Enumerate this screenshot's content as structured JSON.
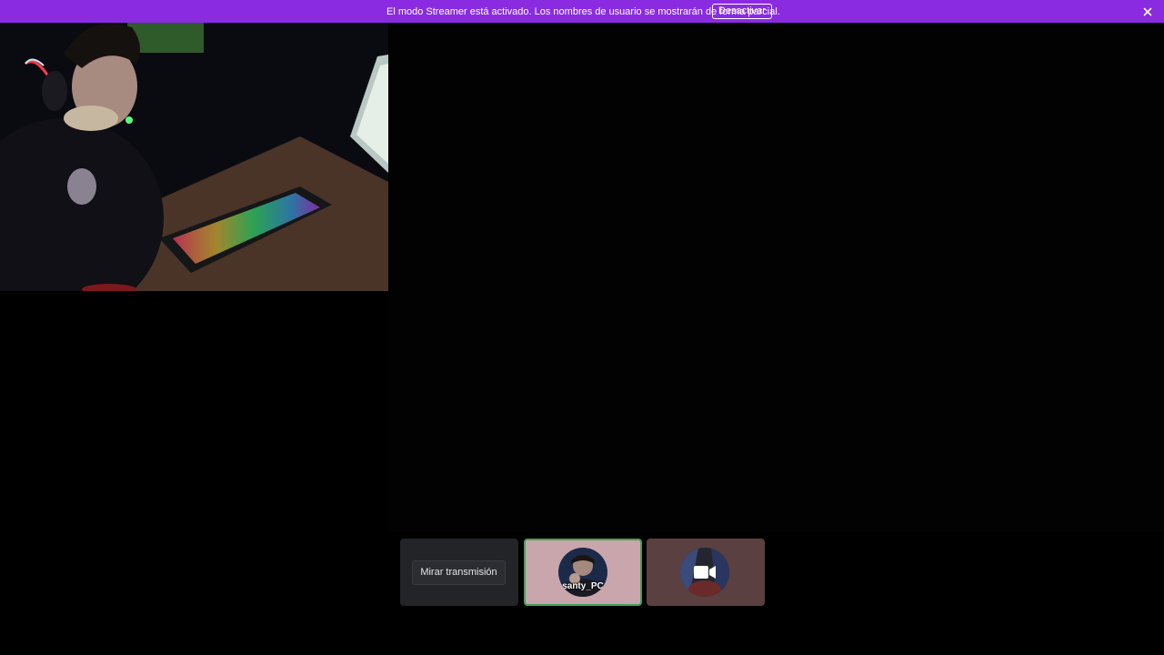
{
  "banner": {
    "message": "El modo Streamer está activado. Los nombres de usuario se mostrarán de forma parcial.",
    "disable_label": "Desactivar",
    "close_icon": "close-icon",
    "color": "#8a2be2"
  },
  "video": {
    "icon": "webcam-feed"
  },
  "tiles": {
    "watch_label": "Mirar transmisión",
    "user_name": "santy_PC",
    "user_speaking_color": "#43a25a",
    "camera_icon": "video-camera-icon"
  }
}
